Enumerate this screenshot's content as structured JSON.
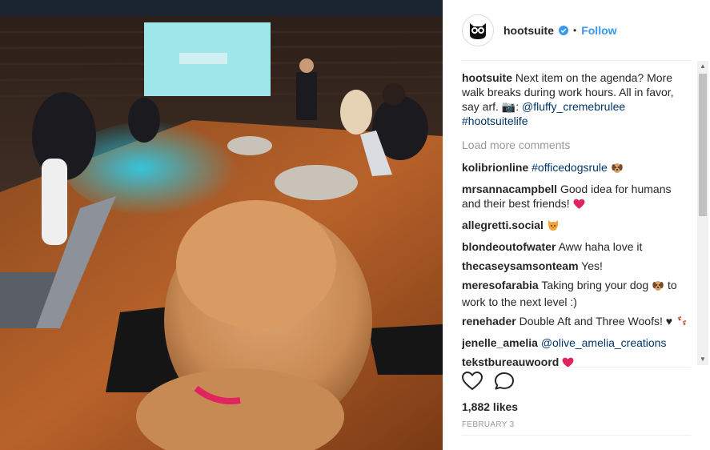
{
  "post": {
    "username": "hootsuite",
    "follow_label": "Follow",
    "separator": "•"
  },
  "caption": {
    "user": "hootsuite",
    "text": "Next item on the agenda? More walk breaks during work hours. All in favor, say arf. 📷: ",
    "mention": "@fluffy_cremebrulee",
    "hashtag": "#hootsuitelife"
  },
  "load_more_label": "Load more comments",
  "comments": [
    {
      "user": "kolibrionline",
      "text": "",
      "link": "#officedogsrule",
      "after": "",
      "emoji": "dog-face"
    },
    {
      "user": "mrsannacampbell",
      "text": "Good idea for humans and their best friends!",
      "link": "",
      "after": "",
      "emoji": "red-heart"
    },
    {
      "user": "allegretti.social",
      "text": "",
      "link": "",
      "after": "",
      "emoji": "cat-face"
    },
    {
      "user": "blondeoutofwater",
      "text": "Aww haha love it",
      "link": "",
      "after": "",
      "emoji": ""
    },
    {
      "user": "thecaseysamsonteam",
      "text": "Yes!",
      "link": "",
      "after": "",
      "emoji": ""
    },
    {
      "user": "meresofarabia",
      "text": "Taking bring your dog",
      "link": "",
      "after": "to work to the next level :)",
      "emoji": "dog-face"
    },
    {
      "user": "renehader",
      "text": "Double Aft and Three Woofs! ♥",
      "link": "",
      "after": "",
      "emoji": "paw-prints"
    },
    {
      "user": "jenelle_amelia",
      "text": "",
      "link": "@olive_amelia_creations",
      "after": "",
      "emoji": ""
    },
    {
      "user": "tekstbureauwoord",
      "text": "",
      "link": "",
      "after": "",
      "emoji": "red-heart"
    }
  ],
  "likes": "1,882 likes",
  "date": "FEBRUARY 3",
  "icons": {
    "like": "heart-outline-icon",
    "comment": "speech-bubble-icon",
    "avatar": "owl-logo-icon",
    "verified": "verified-badge-icon"
  },
  "colors": {
    "link_blue": "#3897f0",
    "text_dark": "#262626",
    "muted": "#999999",
    "heart_red": "#e0245e"
  }
}
